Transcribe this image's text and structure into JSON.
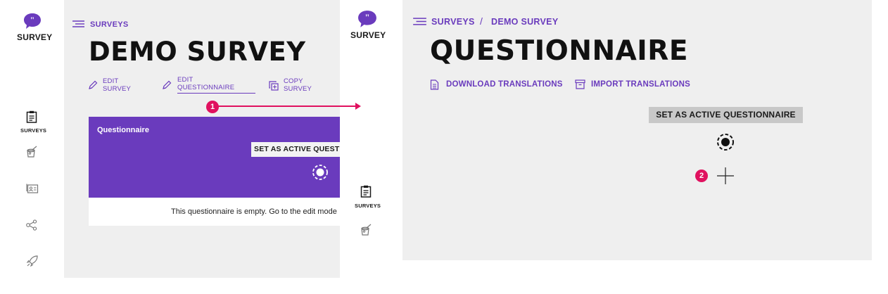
{
  "left": {
    "logo_text": "SURVEY",
    "nav": {
      "surveys_label": "SURVEYS"
    },
    "breadcrumb": {
      "surveys": "SURVEYS"
    },
    "title": "DEMO SURVEY",
    "actions": {
      "edit_survey": [
        "EDIT",
        "SURVEY"
      ],
      "edit_questionnaire": [
        "EDIT",
        "QUESTIONNAIRE"
      ],
      "copy_survey": [
        "COPY",
        "SURVEY"
      ]
    },
    "card": {
      "title": "Questionnaire",
      "set_active_label": "SET AS ACTIVE QUESTIONNAIRE",
      "empty_message": "This questionnaire is empty. Go to the edit mode"
    }
  },
  "middle": {
    "logo_text": "SURVEY",
    "nav": {
      "surveys_label": "SURVEYS"
    }
  },
  "right": {
    "breadcrumb": {
      "surveys": "SURVEYS",
      "separator": "/",
      "current": "DEMO SURVEY"
    },
    "title": "QUESTIONNAIRE",
    "download_translations": "DOWNLOAD TRANSLATIONS",
    "import_translations": "IMPORT TRANSLATIONS",
    "set_active_label": "SET AS ACTIVE QUESTIONNAIRE"
  },
  "annotations": {
    "step1": "1",
    "step2": "2"
  },
  "colors": {
    "brand": "#6a3bbd",
    "annotation": "#e0115f"
  },
  "icons": [
    "speech-bubble-logo-icon",
    "clipboard-icon",
    "paint-bucket-icon",
    "contact-card-icon",
    "share-nodes-icon",
    "rocket-icon",
    "menu-lines-icon",
    "pencil-icon",
    "copy-icon",
    "radio-target-icon",
    "document-icon",
    "archive-box-icon",
    "plus-icon"
  ]
}
